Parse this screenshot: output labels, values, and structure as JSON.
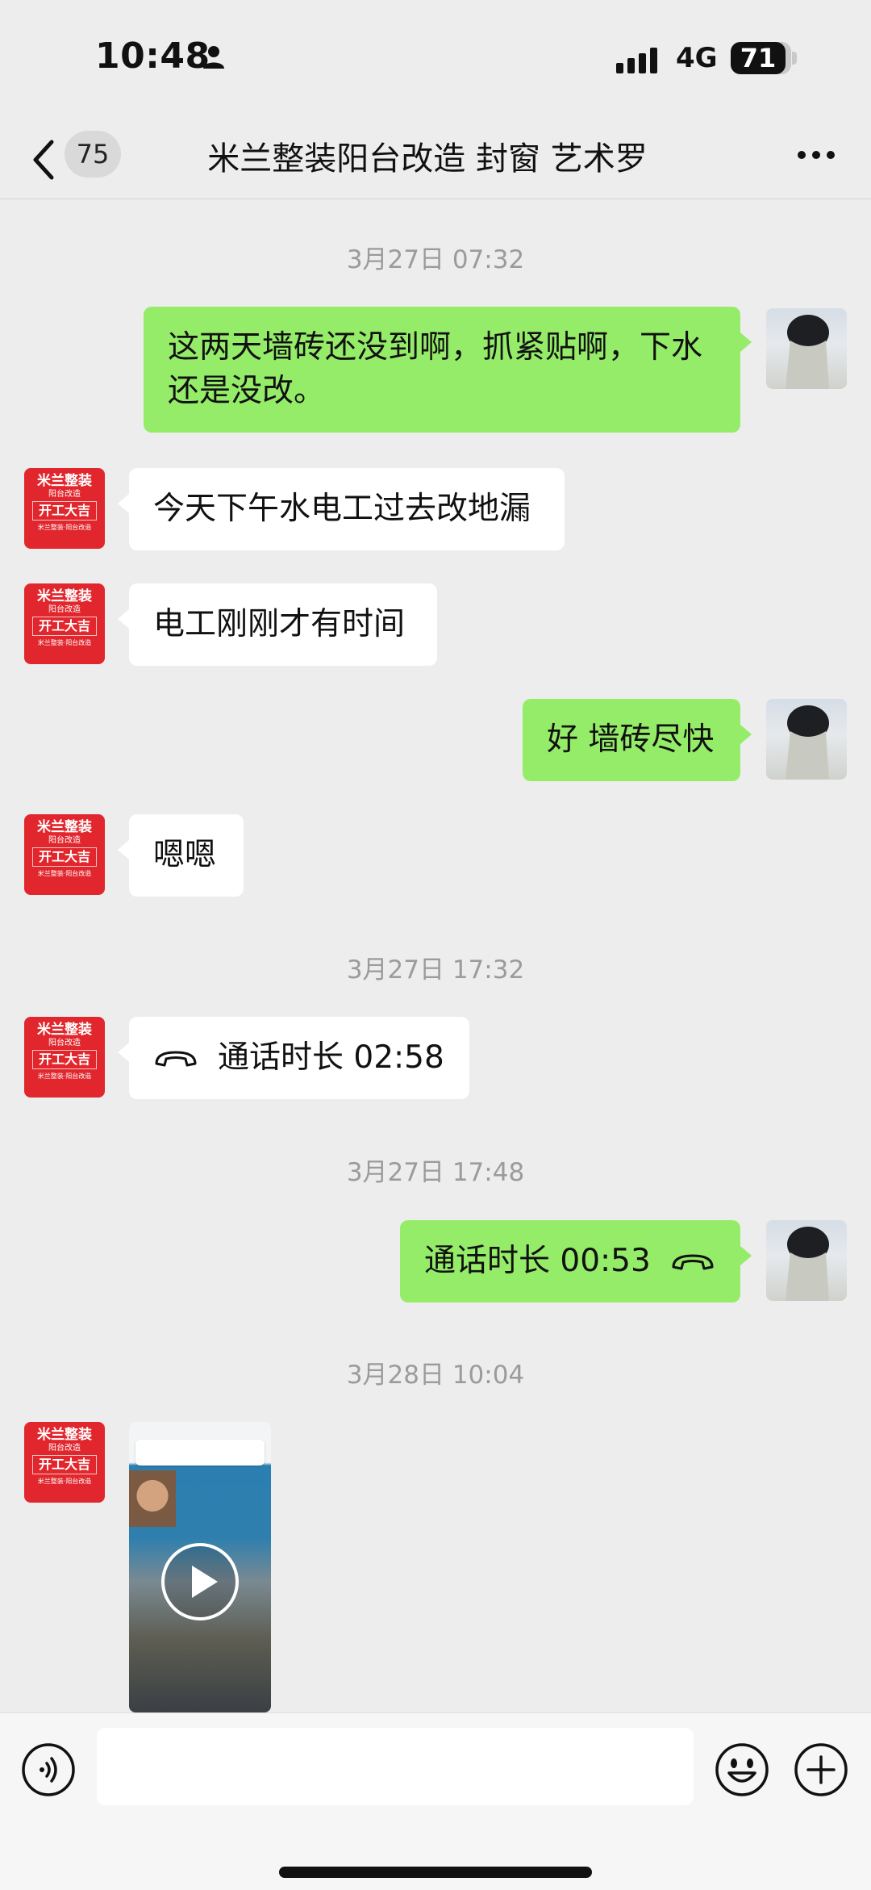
{
  "status_bar": {
    "time": "10:48",
    "network": "4G",
    "battery": "71"
  },
  "header": {
    "unread_count": "75",
    "title": "米兰整装阳台改造   封窗  艺术罗"
  },
  "contact_avatar": {
    "line1": "米兰整装",
    "line2": "阳台改造",
    "line3": "开工大吉",
    "line4": "米兰整装·阳台改造"
  },
  "messages": {
    "ts1": "3月27日 07:32",
    "m1": "这两天墙砖还没到啊，抓紧贴啊，下水还是没改。",
    "m2": "今天下午水电工过去改地漏",
    "m3": "电工刚刚才有时间",
    "m4": "好 墙砖尽快",
    "m5": "嗯嗯",
    "ts2": "3月27日 17:32",
    "call_in": "通话时长 02:58",
    "ts3": "3月27日 17:48",
    "call_out": "通话时长 00:53",
    "ts4": "3月28日 10:04"
  },
  "input": {
    "placeholder": ""
  },
  "colors": {
    "outgoing_bubble": "#95ec69",
    "incoming_bubble": "#ffffff",
    "background": "#ededed",
    "brand_red": "#e1272d"
  },
  "icons": [
    "person-icon",
    "signal-icon",
    "back-icon",
    "more-icon",
    "handset-icon",
    "play-icon",
    "voice-icon",
    "emoji-icon",
    "plus-icon"
  ]
}
